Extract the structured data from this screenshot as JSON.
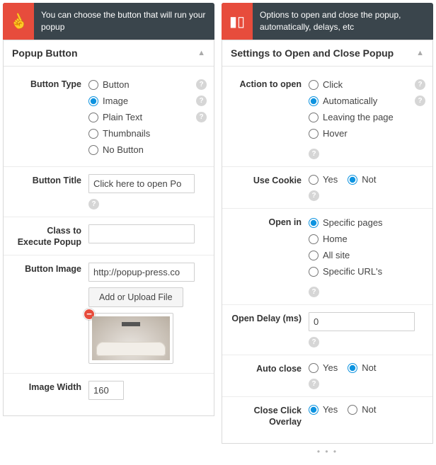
{
  "left": {
    "header": "You can choose the button that will run your popup",
    "panel_title": "Popup Button",
    "button_type": {
      "label": "Button Type",
      "options": [
        "Button",
        "Image",
        "Plain Text",
        "Thumbnails",
        "No Button"
      ],
      "selected": "Image"
    },
    "button_title": {
      "label": "Button Title",
      "value": "Click here to open Po"
    },
    "class_execute": {
      "label": "Class to Execute Popup",
      "value": ""
    },
    "button_image": {
      "label": "Button Image",
      "value": "http://popup-press.co",
      "upload_btn": "Add or Upload File"
    },
    "image_width": {
      "label": "Image Width",
      "value": "160"
    }
  },
  "right": {
    "header": "Options to open and close the popup, automatically, delays, etc",
    "panel_title": "Settings to Open and Close Popup",
    "action_open": {
      "label": "Action to open",
      "options": [
        "Click",
        "Automatically",
        "Leaving the page",
        "Hover"
      ],
      "selected": "Automatically"
    },
    "use_cookie": {
      "label": "Use Cookie",
      "yes": "Yes",
      "no": "Not",
      "selected": "Not"
    },
    "open_in": {
      "label": "Open in",
      "options": [
        "Specific pages",
        "Home",
        "All site",
        "Specific URL's"
      ],
      "selected": "Specific pages"
    },
    "open_delay": {
      "label": "Open Delay (ms)",
      "value": "0"
    },
    "auto_close": {
      "label": "Auto close",
      "yes": "Yes",
      "no": "Not",
      "selected": "Not"
    },
    "close_overlay": {
      "label": "Close Click Overlay",
      "yes": "Yes",
      "no": "Not",
      "selected": "Yes"
    }
  }
}
